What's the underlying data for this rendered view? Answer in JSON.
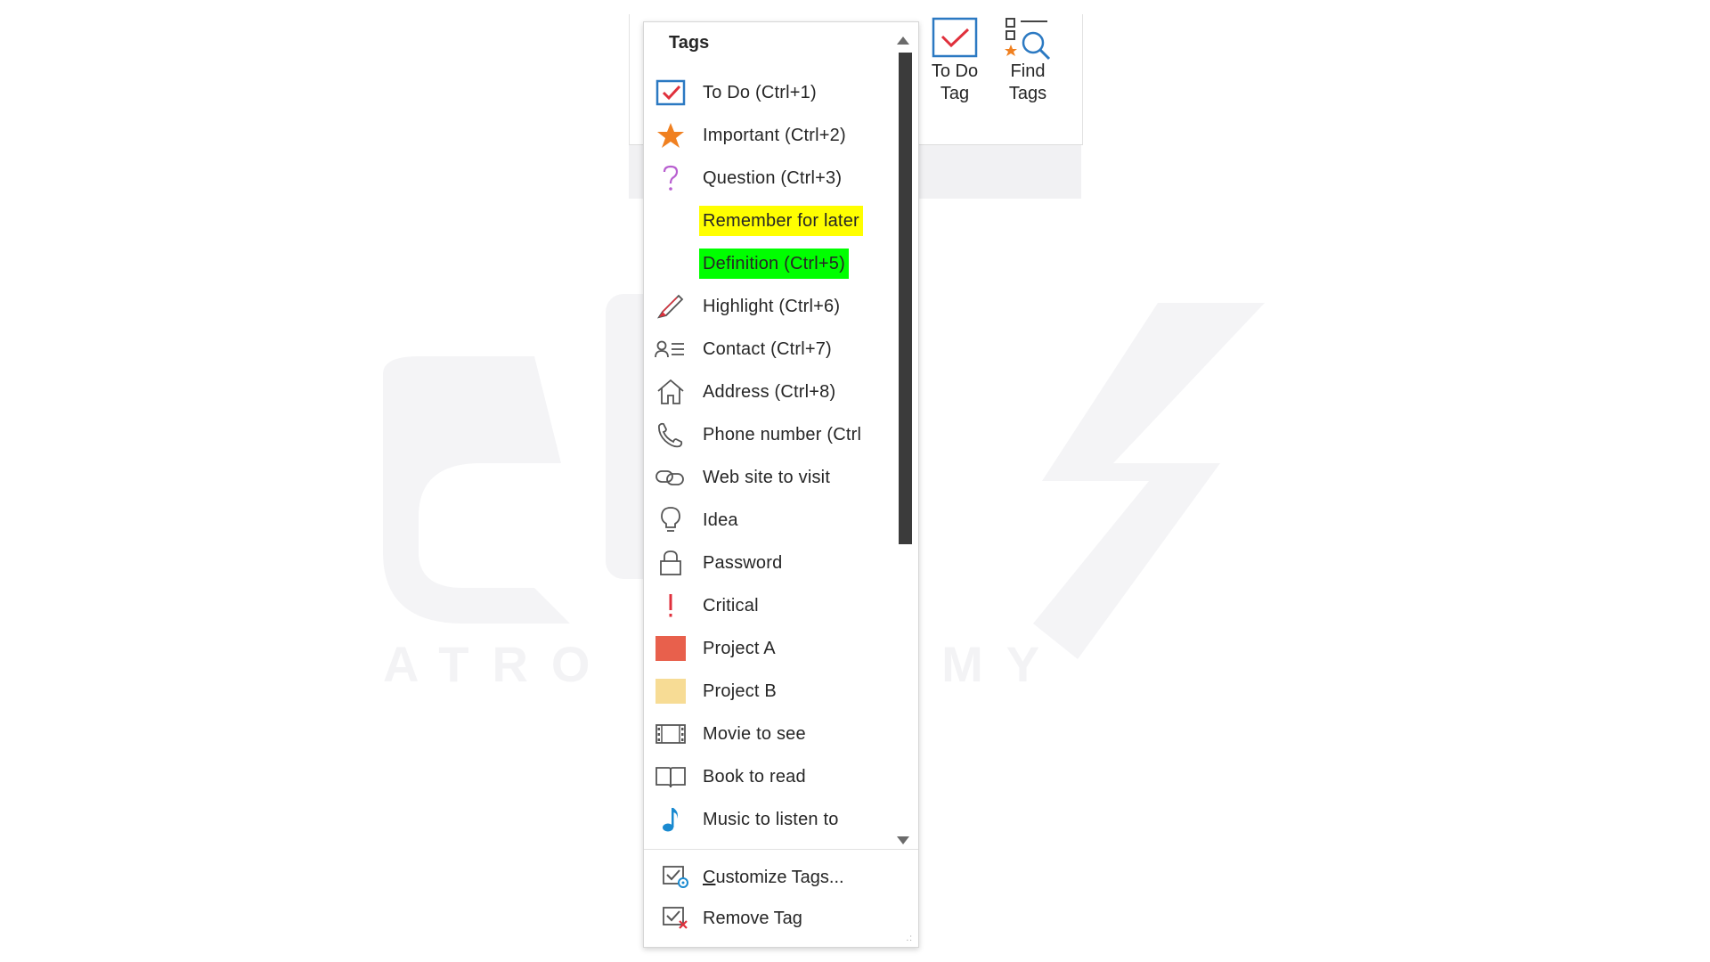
{
  "ribbon": {
    "buttons": [
      {
        "label": "To Do\nTag",
        "icon": "todo-tag-checkbox-icon"
      },
      {
        "label": "Find\nTags",
        "icon": "find-tags-icon"
      }
    ]
  },
  "dropdown": {
    "title": "Tags",
    "items": [
      {
        "label": "To Do (Ctrl+1)",
        "icon": "checkbox-checked-icon"
      },
      {
        "label": "Important (Ctrl+2)",
        "icon": "star-icon"
      },
      {
        "label": "Question (Ctrl+3)",
        "icon": "question-mark-icon"
      },
      {
        "label": "Remember for later",
        "icon": "",
        "highlight": "#ffff00"
      },
      {
        "label": "Definition (Ctrl+5)",
        "icon": "",
        "highlight": "#00ff00"
      },
      {
        "label": "Highlight (Ctrl+6)",
        "icon": "highlighter-pen-icon"
      },
      {
        "label": "Contact (Ctrl+7)",
        "icon": "contact-card-icon"
      },
      {
        "label": "Address (Ctrl+8)",
        "icon": "house-icon"
      },
      {
        "label": "Phone number (Ctrl",
        "icon": "phone-icon"
      },
      {
        "label": "Web site to visit",
        "icon": "link-icon"
      },
      {
        "label": "Idea",
        "icon": "lightbulb-icon"
      },
      {
        "label": "Password",
        "icon": "padlock-icon"
      },
      {
        "label": "Critical",
        "icon": "exclamation-icon"
      },
      {
        "label": "Project A",
        "icon": "red-square-icon"
      },
      {
        "label": "Project B",
        "icon": "yellow-square-icon"
      },
      {
        "label": "Movie to see",
        "icon": "film-strip-icon"
      },
      {
        "label": "Book to read",
        "icon": "open-book-icon"
      },
      {
        "label": "Music to listen to",
        "icon": "music-note-icon"
      }
    ],
    "commands": [
      {
        "label_pre": "",
        "label_u": "C",
        "label_post": "ustomize Tags...",
        "icon": "customize-tags-icon"
      },
      {
        "label_pre": "Remove Ta",
        "label_u": "g",
        "label_post": "",
        "icon": "remove-tag-icon"
      }
    ]
  },
  "colors": {
    "accent_red": "#e0303c",
    "star_orange": "#f08020",
    "question_purple": "#b85fd0",
    "project_a": "#e8604c",
    "project_b": "#f7dc95",
    "music_blue": "#1a8ad0",
    "checkbox_blue": "#2b79c2"
  },
  "watermark": {
    "text": "ATRO ACADEMY"
  }
}
